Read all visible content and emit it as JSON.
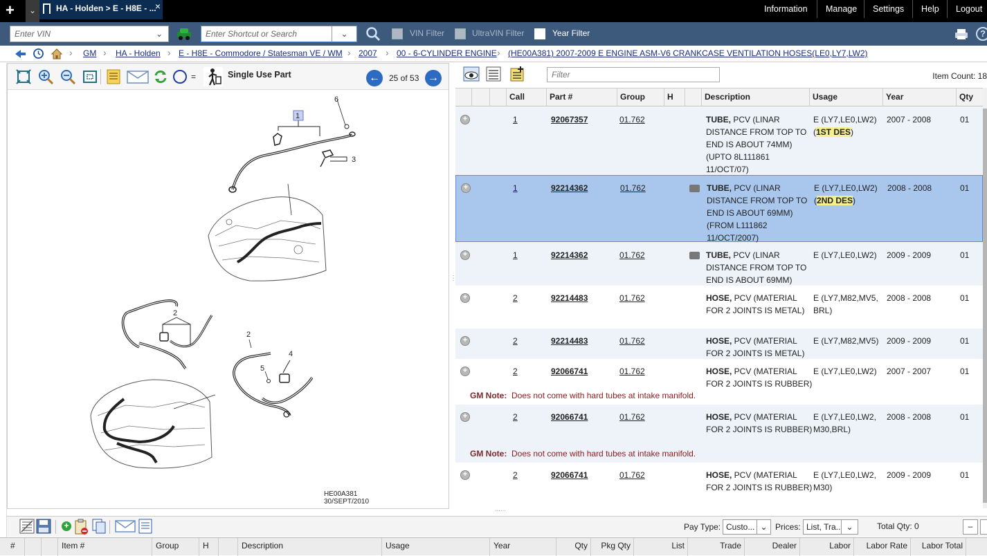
{
  "top": {
    "tab_title": "HA - Holden > E - H8E - ...",
    "tab_close": "×",
    "new_tab": "+",
    "tab_menu": "⌄",
    "nav": [
      "Information",
      "Manage",
      "Settings",
      "Help",
      "Logout"
    ]
  },
  "vinbar": {
    "vin_placeholder": "Enter VIN",
    "search_placeholder": "Enter Shortcut or Search",
    "vin_filter": "VIN Filter",
    "ultravin_filter": "UltraVIN Filter",
    "year_filter": "Year Filter",
    "year_filter_checked": true
  },
  "breadcrumb": [
    "GM",
    "HA - Holden",
    "E - H8E - Commodore / Statesman VE / WM",
    "2007",
    "00 - 6-CYLINDER ENGINE",
    "(HE00A381)   2007-2009   E   ENGINE ASM-V6 CRANKCASE VENTILATION HOSES(LE0,LY7,LW2)"
  ],
  "left": {
    "legend_equals": "=",
    "single_use_label": "Single Use Part",
    "page_info": "25 of 53",
    "page_current": 25,
    "page_total": 53,
    "diagram_id": "HE00A381",
    "diagram_date": "30/SEPT/2010",
    "callouts": [
      "1",
      "6",
      "3",
      "2",
      "2",
      "4",
      "5"
    ]
  },
  "right": {
    "filter_placeholder": "Filter",
    "item_count_label": "Item Count: 18",
    "columns": [
      "Call",
      "Part #",
      "Group",
      "H",
      "Description",
      "Usage",
      "Year",
      "Qty"
    ]
  },
  "rows": [
    {
      "call": "1",
      "part": "92067357",
      "group": "01.762",
      "desc_bold": "TUBE,",
      "desc_rest": " PCV (LINAR DISTANCE FROM TOP TO END IS ABOUT 74MM) (UPTO 8L111861 11/OCT/07)",
      "usage": "E (LY7,LE0,LW2)",
      "usage_hl": "1ST DES",
      "year": "2007 - 2008",
      "qty": "01"
    },
    {
      "call": "1",
      "part": "92214362",
      "group": "01.762",
      "desc_bold": "TUBE,",
      "desc_rest": " PCV (LINAR DISTANCE FROM TOP TO END IS ABOUT 69MM) (FROM L111862 11/OCT/2007)",
      "usage": "E (LY7,LE0,LW2)",
      "usage_hl": "2ND DES",
      "year": "2008 - 2008",
      "qty": "01"
    },
    {
      "call": "1",
      "part": "92214362",
      "group": "01.762",
      "desc_bold": "TUBE,",
      "desc_rest": " PCV (LINAR DISTANCE FROM TOP TO END IS ABOUT 69MM)",
      "usage": "E (LY7,LE0,LW2)",
      "year": "2009 - 2009",
      "qty": "01"
    },
    {
      "call": "2",
      "part": "92214483",
      "group": "01.762",
      "desc_bold": "HOSE,",
      "desc_rest": " PCV (MATERIAL FOR 2 JOINTS IS METAL)",
      "usage": "E (LY7,M82,MV5,BRL)",
      "year": "2008 - 2008",
      "qty": "01"
    },
    {
      "call": "2",
      "part": "92214483",
      "group": "01.762",
      "desc_bold": "HOSE,",
      "desc_rest": " PCV (MATERIAL FOR 2 JOINTS IS METAL)",
      "usage": "E (LY7,M82,MV5)",
      "year": "2009 - 2009",
      "qty": "01"
    },
    {
      "call": "2",
      "part": "92066741",
      "group": "01.762",
      "desc_bold": "HOSE,",
      "desc_rest": " PCV (MATERIAL FOR 2 JOINTS IS RUBBER)",
      "usage": "E (LY7,LE0,LW2)",
      "year": "2007 - 2007",
      "qty": "01",
      "note_label": "GM Note:",
      "note": "Does not come with hard tubes at intake manifold."
    },
    {
      "call": "2",
      "part": "92066741",
      "group": "01.762",
      "desc_bold": "HOSE,",
      "desc_rest": " PCV (MATERIAL FOR 2 JOINTS IS RUBBER)",
      "usage": "E (LY7,LE0,LW2,M30,BRL)",
      "year": "2008 - 2008",
      "qty": "01",
      "note_label": "GM Note:",
      "note": "Does not come with hard tubes at intake manifold."
    },
    {
      "call": "2",
      "part": "92066741",
      "group": "01.762",
      "desc_bold": "HOSE,",
      "desc_rest": " PCV (MATERIAL FOR 2 JOINTS IS RUBBER)",
      "usage": "E (LY7,LE0,LW2,M30)",
      "year": "2009 - 2009",
      "qty": "01"
    }
  ],
  "bottom": {
    "pay_type_label": "Pay Type:",
    "pay_type_value": "Custo...",
    "prices_label": "Prices:",
    "prices_value": "List, Tra...",
    "total_qty": "Total Qty: 0",
    "columns": [
      "#",
      "Item #",
      "Group",
      "H",
      "Description",
      "Usage",
      "Year",
      "Qty",
      "Pkg Qty",
      "List",
      "Trade",
      "Dealer",
      "Labor",
      "Labor Rate",
      "Labor Total"
    ]
  },
  "colors": {
    "topbar": "#000000",
    "tab": "#0b2d52",
    "vinbar": "#3d5a7c",
    "selected_row": "#a9c6ec",
    "highlight": "#f6f08a",
    "accent_blue": "#2d6bc2"
  }
}
